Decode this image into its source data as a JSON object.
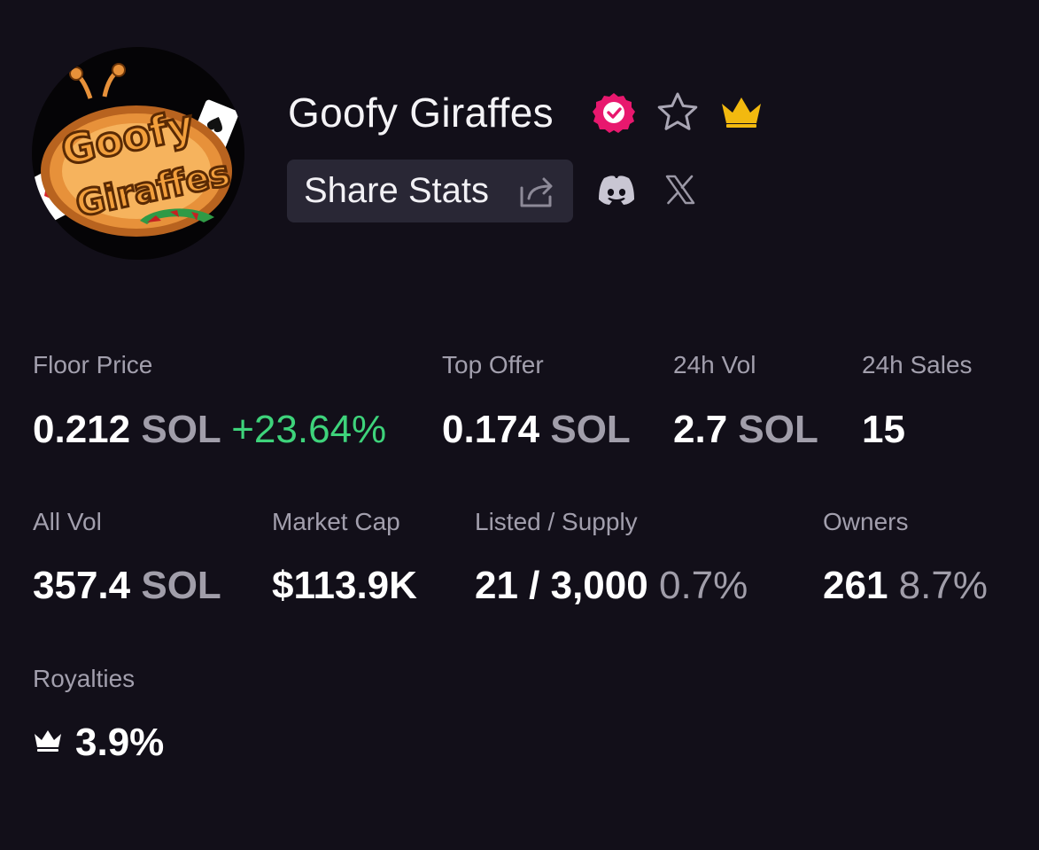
{
  "collection": {
    "name": "Goofy Giraffes",
    "logo_text": [
      "Goofy",
      "Giraffes"
    ],
    "verified": true
  },
  "actions": {
    "share_label": "Share Stats",
    "icons": [
      "verified-badge-icon",
      "star-icon",
      "crown-icon",
      "share-icon",
      "discord-icon",
      "x-icon"
    ]
  },
  "stats": {
    "floor": {
      "label": "Floor Price",
      "value": "0.212",
      "unit": "SOL",
      "change": "+23.64%"
    },
    "top_offer": {
      "label": "Top Offer",
      "value": "0.174",
      "unit": "SOL"
    },
    "vol_24h": {
      "label": "24h Vol",
      "value": "2.7",
      "unit": "SOL"
    },
    "sales_24h": {
      "label": "24h Sales",
      "value": "15"
    },
    "all_vol": {
      "label": "All Vol",
      "value": "357.4",
      "unit": "SOL"
    },
    "market_cap": {
      "label": "Market Cap",
      "value": "$113.9K"
    },
    "listed_supply": {
      "label": "Listed / Supply",
      "value": "21 / 3,000",
      "percent": "0.7%"
    },
    "owners": {
      "label": "Owners",
      "value": "261",
      "percent": "8.7%"
    },
    "royalties": {
      "label": "Royalties",
      "value": "3.9%"
    }
  },
  "colors": {
    "background": "#120f19",
    "positive": "#3ed37b",
    "verified": "#e8186e",
    "crown": "#f2b90f",
    "button": "#292735",
    "muted": "#a29fad"
  }
}
